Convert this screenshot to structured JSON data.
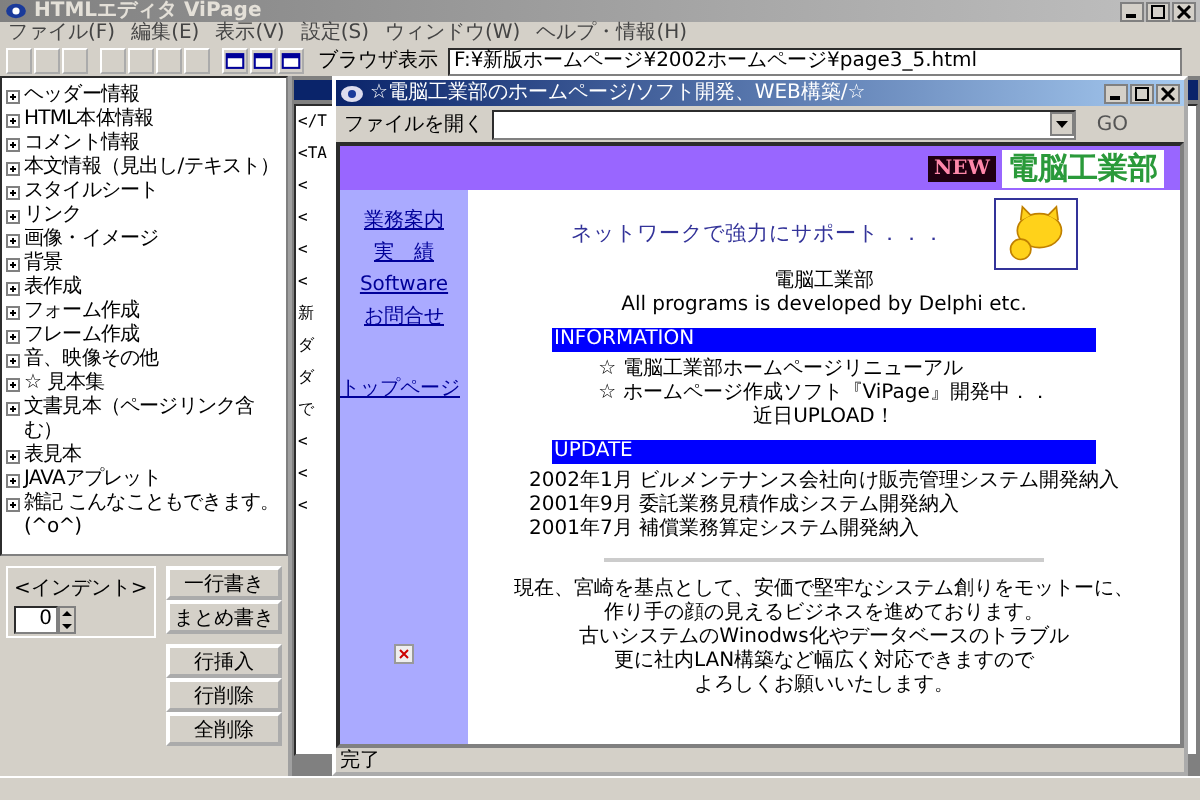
{
  "app": {
    "title": "HTMLエディタ ViPage"
  },
  "menu": [
    "ファイル(F)",
    "編集(E)",
    "表示(V)",
    "設定(S)",
    "ウィンドウ(W)",
    "ヘルプ・情報(H)"
  ],
  "toolbar": {
    "path_label": "ブラウザ表示",
    "path_value": "F:¥新版ホームページ¥2002ホームページ¥page3_5.html"
  },
  "tree": [
    {
      "label": "ヘッダー情報",
      "expanded": false
    },
    {
      "label": "HTML本体情報",
      "expanded": false
    },
    {
      "label": "コメント情報",
      "expanded": false
    },
    {
      "label": "本文情報（見出し/テキスト）",
      "expanded": false
    },
    {
      "label": "スタイルシート",
      "expanded": false
    },
    {
      "label": "リンク",
      "expanded": false
    },
    {
      "label": "画像・イメージ",
      "expanded": false
    },
    {
      "label": "背景",
      "expanded": false
    },
    {
      "label": "表作成",
      "expanded": false
    },
    {
      "label": "フォーム作成",
      "expanded": false
    },
    {
      "label": "フレーム作成",
      "expanded": false
    },
    {
      "label": "音、映像その他",
      "expanded": false
    },
    {
      "label": "☆ 見本集",
      "expanded": false
    },
    {
      "label": "文書見本（ページリンク含む）",
      "expanded": false
    },
    {
      "label": "表見本",
      "expanded": false
    },
    {
      "label": "JAVAアプレット",
      "expanded": false
    },
    {
      "label": "雑記 こんなこともできます。(^o^)",
      "expanded": false
    }
  ],
  "indent": {
    "label": "<インデント>",
    "value": "0"
  },
  "buttons": [
    [
      "一行書き",
      "まとめ書き"
    ],
    [
      "行挿入",
      "行削除",
      "全削除"
    ]
  ],
  "editor": {
    "lines": [
      "</T",
      "<TA",
      "<",
      "<",
      "<",
      "<",
      "新",
      "ダ",
      "ダ",
      "で",
      "<",
      "<",
      "<"
    ]
  },
  "preview": {
    "title": "☆電脳工業部のホームページ/ソフト開発、WEB構築/☆",
    "file_label": "ファイルを開く",
    "go": "GO",
    "status": "完了",
    "page": {
      "new_banner": "NEW",
      "logo": "電脳工業部",
      "nav": [
        "業務案内",
        "実　績",
        "Software",
        "お問合せ"
      ],
      "nav_bottom": "トップページ",
      "headline": "ネットワークで強力にサポート．．．",
      "org": "電脳工業部",
      "tagline": "All programs is developed by Delphi etc.",
      "sections": [
        {
          "heading": "INFORMATION",
          "lines": [
            "☆ 電脳工業部ホームページリニューアル",
            "☆ ホームページ作成ソフト『ViPage』開発中．．",
            "近日UPLOAD！"
          ]
        },
        {
          "heading": "UPDATE",
          "lines": [
            "2002年1月 ビルメンテナンス会社向け販売管理システム開発納入",
            "2001年9月 委託業務見積作成システム開発納入",
            "2001年7月 補償業務算定システム開発納入"
          ]
        }
      ],
      "paragraph": [
        "現在、宮崎を基点として、安価で堅牢なシステム創りをモットーに、",
        "作り手の顔の見えるビジネスを進めております。",
        "古いシステムのWinodws化やデータベースのトラブル",
        "更に社内LAN構築など幅広く対応できますので",
        "よろしくお願いいたします。"
      ]
    }
  }
}
